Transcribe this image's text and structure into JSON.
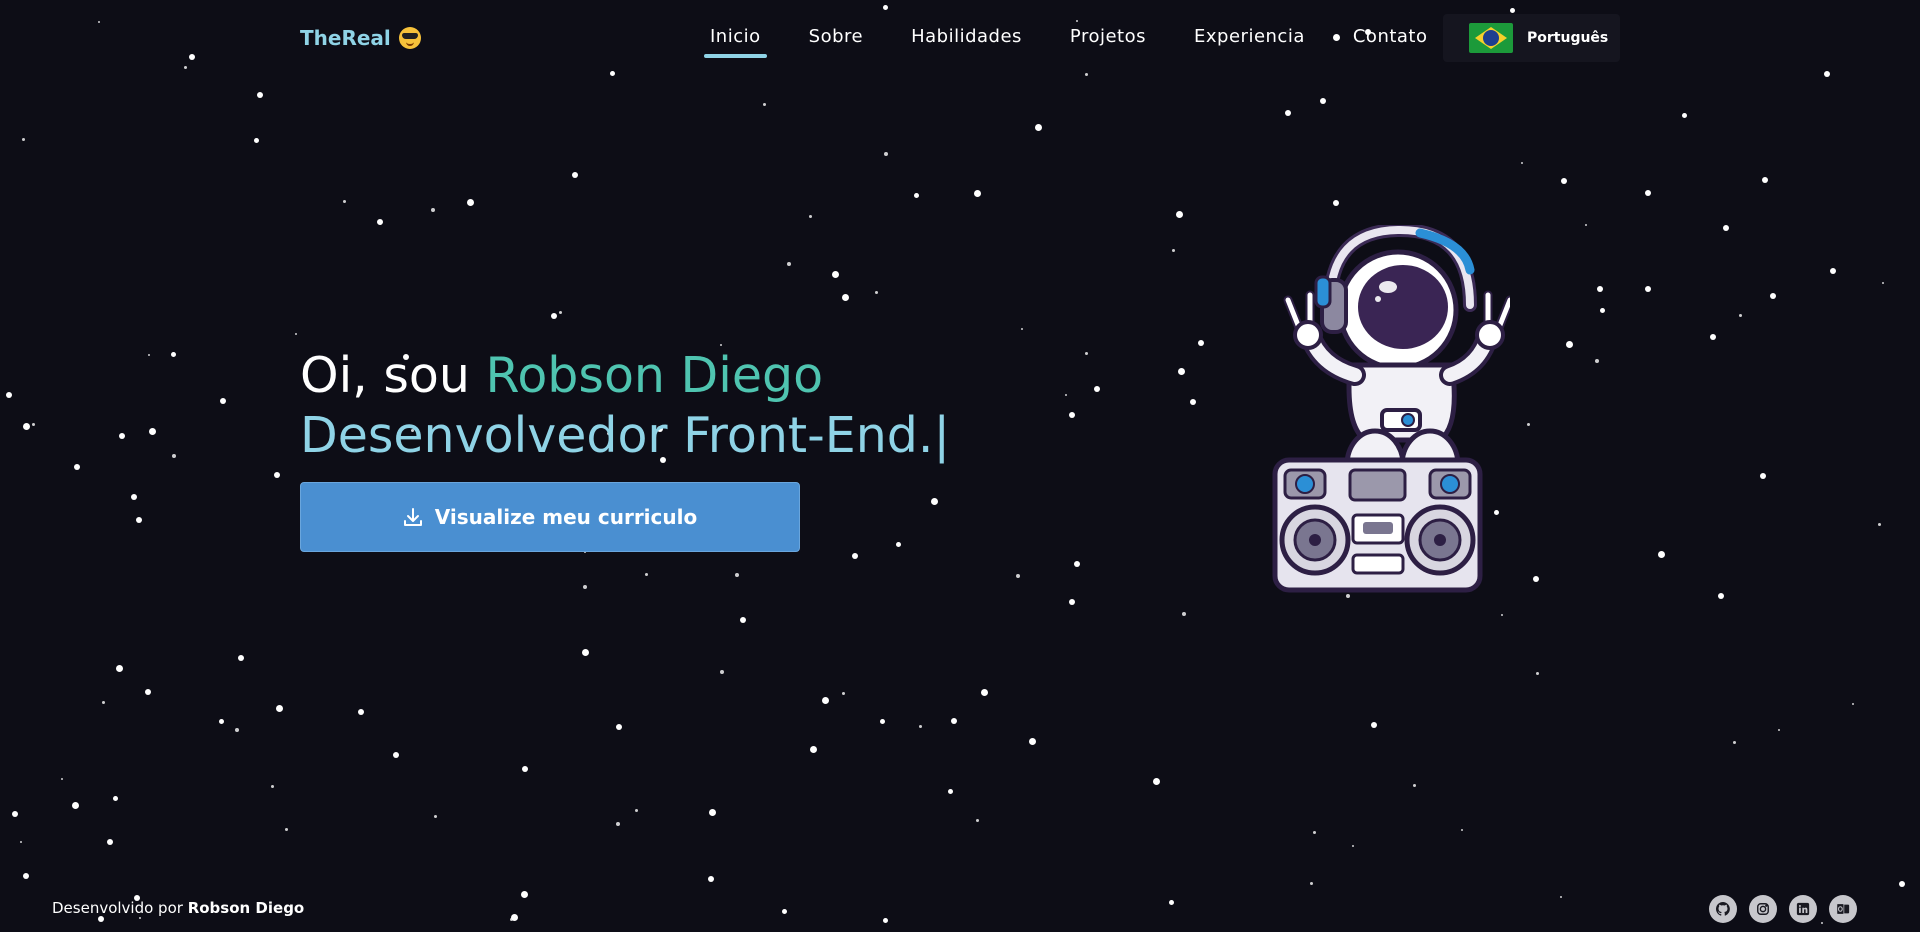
{
  "header": {
    "logo_text": "TheReal",
    "nav": [
      {
        "label": "Inicio",
        "active": true
      },
      {
        "label": "Sobre",
        "active": false
      },
      {
        "label": "Habilidades",
        "active": false
      },
      {
        "label": "Projetos",
        "active": false
      },
      {
        "label": "Experiencia",
        "active": false
      },
      {
        "label": "Contato",
        "active": false
      }
    ],
    "language": "Português"
  },
  "hero": {
    "greeting": "Oi, sou ",
    "name": "Robson Diego",
    "role": "Desenvolvedor Front-End.",
    "cursor": "|",
    "cv_button": "Visualize meu curriculo"
  },
  "footer": {
    "credit_prefix": "Desenvolvido por ",
    "credit_name": "Robson Diego",
    "socials": [
      "github-icon",
      "instagram-icon",
      "linkedin-icon",
      "outlook-icon"
    ]
  },
  "colors": {
    "background": "#0d0d16",
    "accent_teal": "#4fc4b0",
    "accent_light_blue": "#8fd3e6",
    "button_blue": "#4a8fd1"
  }
}
